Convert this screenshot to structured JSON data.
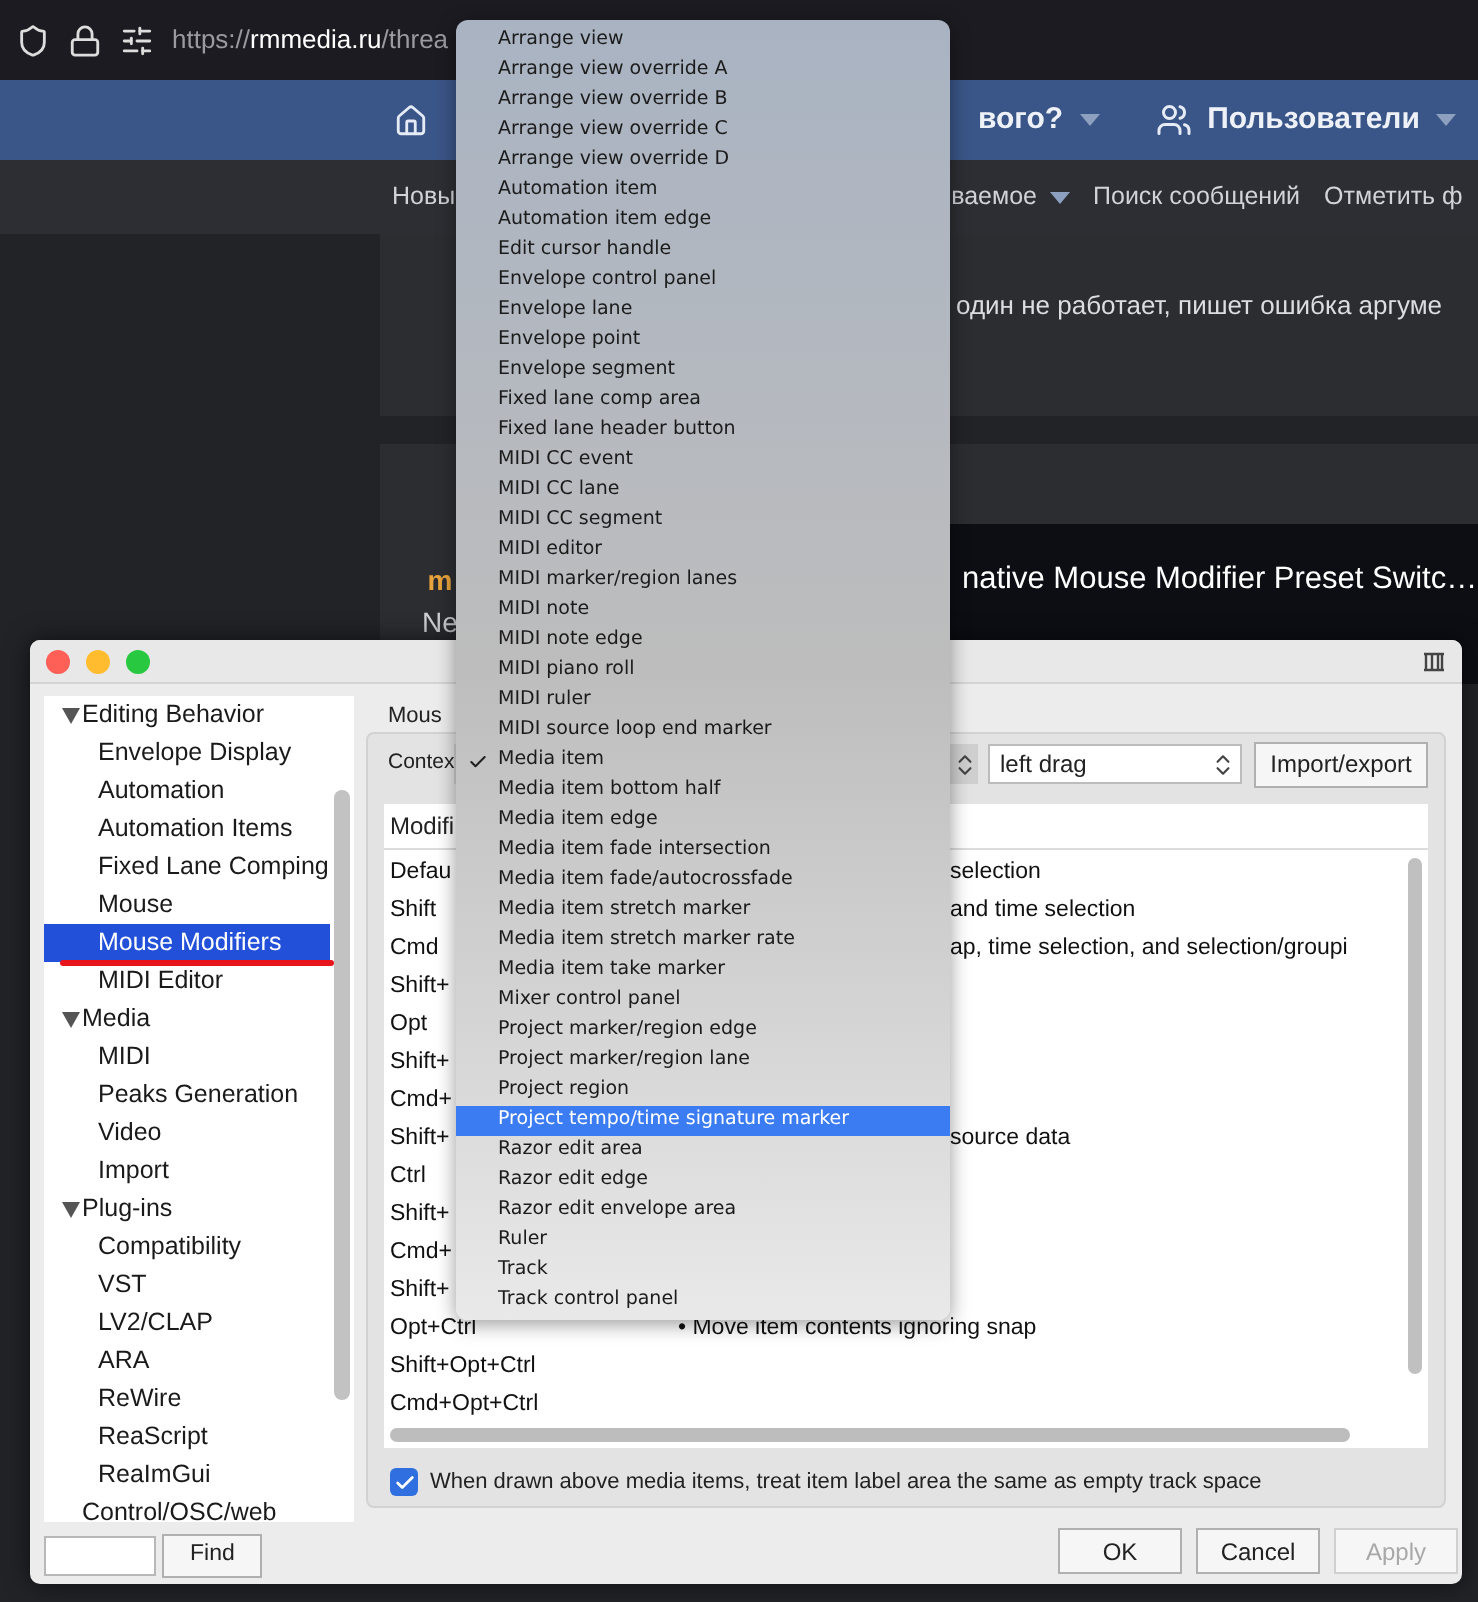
{
  "browser": {
    "url_scheme": "https://",
    "url_host": "rmmedia.ru",
    "url_path": "/threa"
  },
  "site_nav": {
    "items": [
      {
        "label": "вого?",
        "dropdown": true
      },
      {
        "label": "Пользователи",
        "dropdown": true
      }
    ]
  },
  "sub_nav": {
    "items": [
      {
        "label": "Новы",
        "dropdown": false
      },
      {
        "label": "ваемое",
        "dropdown": true
      },
      {
        "label": "Поиск сообщений",
        "dropdown": false
      },
      {
        "label": "Отметить ф",
        "dropdown": false
      }
    ]
  },
  "post": {
    "text": "один не работает, пишет ошибка аргуме"
  },
  "post_2": {
    "author": "m",
    "author_title": "Ne",
    "video_title": "native Mouse Modifier Preset Switc…"
  },
  "dialog": {
    "sidebar": {
      "items": [
        {
          "label": "Editing Behavior",
          "expanded": true,
          "selected": false,
          "children": [
            {
              "label": "Envelope Display",
              "selected": false
            },
            {
              "label": "Automation",
              "selected": false
            },
            {
              "label": "Automation Items",
              "selected": false
            },
            {
              "label": "Fixed Lane Comping",
              "selected": false
            },
            {
              "label": "Mouse",
              "selected": false
            },
            {
              "label": "Mouse Modifiers",
              "selected": true
            },
            {
              "label": "MIDI Editor",
              "selected": false
            }
          ]
        },
        {
          "label": "Media",
          "expanded": true,
          "selected": false,
          "children": [
            {
              "label": "MIDI",
              "selected": false
            },
            {
              "label": "Peaks Generation",
              "selected": false
            },
            {
              "label": "Video",
              "selected": false
            },
            {
              "label": "Import",
              "selected": false
            }
          ]
        },
        {
          "label": "Plug-ins",
          "expanded": true,
          "selected": false,
          "children": [
            {
              "label": "Compatibility",
              "selected": false
            },
            {
              "label": "VST",
              "selected": false
            },
            {
              "label": "LV2/CLAP",
              "selected": false
            },
            {
              "label": "ARA",
              "selected": false
            },
            {
              "label": "ReWire",
              "selected": false
            },
            {
              "label": "ReaScript",
              "selected": false
            },
            {
              "label": "ReaImGui",
              "selected": false
            }
          ]
        },
        {
          "label": "Control/OSC/web",
          "selected": false
        }
      ]
    },
    "find_button": "Find",
    "section_label": "Mous",
    "context_label": "Contex",
    "action_select": "left drag",
    "import_button": "Import/export",
    "table": {
      "header": "Modifi",
      "rows": [
        {
          "modifier": "Defau",
          "action": "selection"
        },
        {
          "modifier": "Shift",
          "action": "and time selection"
        },
        {
          "modifier": "Cmd",
          "action": "ap, time selection, and selection/groupi"
        },
        {
          "modifier": "Shift+"
        },
        {
          "modifier": "Opt"
        },
        {
          "modifier": "Shift+"
        },
        {
          "modifier": "Cmd+"
        },
        {
          "modifier": "Shift+",
          "action": "source data"
        },
        {
          "modifier": "Ctrl"
        },
        {
          "modifier": "Shift+"
        },
        {
          "modifier": "Cmd+"
        },
        {
          "modifier": "Shift+"
        },
        {
          "modifier": "Opt+Ctrl",
          "action": "• Move item contents ignoring snap"
        },
        {
          "modifier": "Shift+Opt+Ctrl"
        },
        {
          "modifier": "Cmd+Opt+Ctrl"
        }
      ]
    },
    "checkbox": {
      "label": "When drawn above media items, treat item label area the same as empty track space",
      "checked": true
    },
    "buttons": [
      {
        "label": "OK",
        "disabled": false
      },
      {
        "label": "Cancel",
        "disabled": false
      },
      {
        "label": "Apply",
        "disabled": true
      }
    ]
  },
  "context_menu": {
    "items": [
      {
        "label": "Arrange view",
        "checked": false,
        "selected": false
      },
      {
        "label": "Arrange view override A",
        "checked": false,
        "selected": false
      },
      {
        "label": "Arrange view override B",
        "checked": false,
        "selected": false
      },
      {
        "label": "Arrange view override C",
        "checked": false,
        "selected": false
      },
      {
        "label": "Arrange view override D",
        "checked": false,
        "selected": false
      },
      {
        "label": "Automation item",
        "checked": false,
        "selected": false
      },
      {
        "label": "Automation item edge",
        "checked": false,
        "selected": false
      },
      {
        "label": "Edit cursor handle",
        "checked": false,
        "selected": false
      },
      {
        "label": "Envelope control panel",
        "checked": false,
        "selected": false
      },
      {
        "label": "Envelope lane",
        "checked": false,
        "selected": false
      },
      {
        "label": "Envelope point",
        "checked": false,
        "selected": false
      },
      {
        "label": "Envelope segment",
        "checked": false,
        "selected": false
      },
      {
        "label": "Fixed lane comp area",
        "checked": false,
        "selected": false
      },
      {
        "label": "Fixed lane header button",
        "checked": false,
        "selected": false
      },
      {
        "label": "MIDI CC event",
        "checked": false,
        "selected": false
      },
      {
        "label": "MIDI CC lane",
        "checked": false,
        "selected": false
      },
      {
        "label": "MIDI CC segment",
        "checked": false,
        "selected": false
      },
      {
        "label": "MIDI editor",
        "checked": false,
        "selected": false
      },
      {
        "label": "MIDI marker/region lanes",
        "checked": false,
        "selected": false
      },
      {
        "label": "MIDI note",
        "checked": false,
        "selected": false
      },
      {
        "label": "MIDI note edge",
        "checked": false,
        "selected": false
      },
      {
        "label": "MIDI piano roll",
        "checked": false,
        "selected": false
      },
      {
        "label": "MIDI ruler",
        "checked": false,
        "selected": false
      },
      {
        "label": "MIDI source loop end marker",
        "checked": false,
        "selected": false
      },
      {
        "label": "Media item",
        "checked": true,
        "selected": false
      },
      {
        "label": "Media item bottom half",
        "checked": false,
        "selected": false
      },
      {
        "label": "Media item edge",
        "checked": false,
        "selected": false
      },
      {
        "label": "Media item fade intersection",
        "checked": false,
        "selected": false
      },
      {
        "label": "Media item fade/autocrossfade",
        "checked": false,
        "selected": false
      },
      {
        "label": "Media item stretch marker",
        "checked": false,
        "selected": false
      },
      {
        "label": "Media item stretch marker rate",
        "checked": false,
        "selected": false
      },
      {
        "label": "Media item take marker",
        "checked": false,
        "selected": false
      },
      {
        "label": "Mixer control panel",
        "checked": false,
        "selected": false
      },
      {
        "label": "Project marker/region edge",
        "checked": false,
        "selected": false
      },
      {
        "label": "Project marker/region lane",
        "checked": false,
        "selected": false
      },
      {
        "label": "Project region",
        "checked": false,
        "selected": false
      },
      {
        "label": "Project tempo/time signature marker",
        "checked": false,
        "selected": true
      },
      {
        "label": "Razor edit area",
        "checked": false,
        "selected": false
      },
      {
        "label": "Razor edit edge",
        "checked": false,
        "selected": false
      },
      {
        "label": "Razor edit envelope area",
        "checked": false,
        "selected": false
      },
      {
        "label": "Ruler",
        "checked": false,
        "selected": false
      },
      {
        "label": "Track",
        "checked": false,
        "selected": false
      },
      {
        "label": "Track control panel",
        "checked": false,
        "selected": false
      }
    ]
  }
}
